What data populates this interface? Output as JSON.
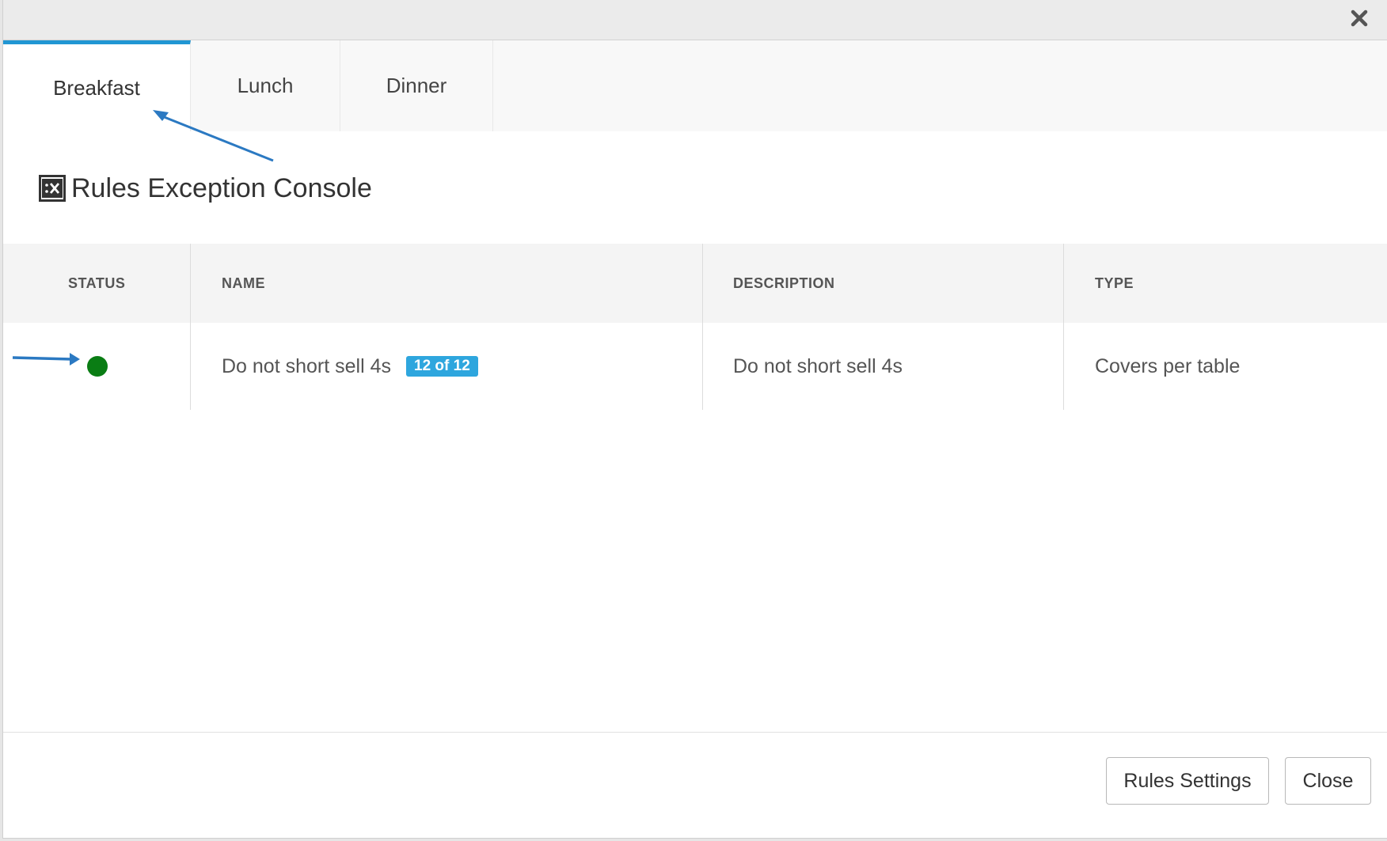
{
  "tabs": [
    {
      "label": "Breakfast",
      "active": true
    },
    {
      "label": "Lunch",
      "active": false
    },
    {
      "label": "Dinner",
      "active": false
    }
  ],
  "console": {
    "title": "Rules Exception Console",
    "icon": "console-x-icon"
  },
  "table": {
    "columns": [
      "STATUS",
      "NAME",
      "DESCRIPTION",
      "TYPE"
    ],
    "rows": [
      {
        "status": "active",
        "status_color": "#0a7d14",
        "name": "Do not short sell 4s",
        "badge": "12 of 12",
        "description": "Do not short sell 4s",
        "type": "Covers per table"
      }
    ]
  },
  "footer": {
    "rules_settings_label": "Rules Settings",
    "close_label": "Close"
  },
  "colors": {
    "accent": "#2196d3",
    "badge": "#2ea6de",
    "annotation_arrow": "#2b79c2"
  }
}
